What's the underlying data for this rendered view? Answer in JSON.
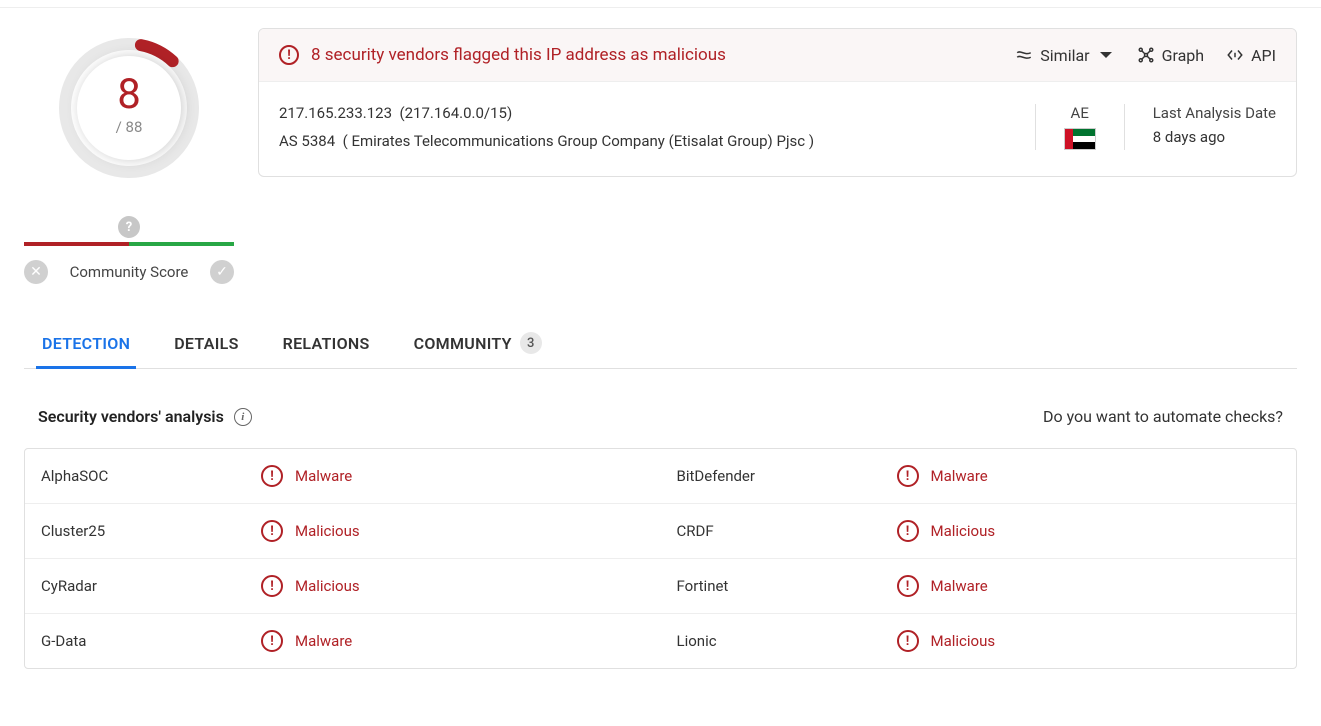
{
  "score": {
    "value": "8",
    "total": "/ 88"
  },
  "community": {
    "pin": "?",
    "label": "Community Score",
    "no_icon": "✕",
    "yes_icon": "✓"
  },
  "header": {
    "alert_text": "8 security vendors flagged this IP address as malicious",
    "similar": "Similar",
    "graph": "Graph",
    "api": "API"
  },
  "info": {
    "ip": "217.165.233.123",
    "cidr": "(217.164.0.0/15)",
    "asn": "AS 5384",
    "as_org": "( Emirates Telecommunications Group Company (Etisalat Group) Pjsc )",
    "country": "AE",
    "date_label": "Last Analysis Date",
    "date_value": "8 days ago"
  },
  "tabs": {
    "detection": "DETECTION",
    "details": "DETAILS",
    "relations": "RELATIONS",
    "community": "COMMUNITY",
    "community_count": "3"
  },
  "vendors": {
    "title": "Security vendors' analysis",
    "automate": "Do you want to automate checks?",
    "rows": [
      [
        {
          "name": "AlphaSOC",
          "verdict": "Malware"
        },
        {
          "name": "BitDefender",
          "verdict": "Malware"
        }
      ],
      [
        {
          "name": "Cluster25",
          "verdict": "Malicious"
        },
        {
          "name": "CRDF",
          "verdict": "Malicious"
        }
      ],
      [
        {
          "name": "CyRadar",
          "verdict": "Malicious"
        },
        {
          "name": "Fortinet",
          "verdict": "Malware"
        }
      ],
      [
        {
          "name": "G-Data",
          "verdict": "Malware"
        },
        {
          "name": "Lionic",
          "verdict": "Malicious"
        }
      ]
    ]
  }
}
